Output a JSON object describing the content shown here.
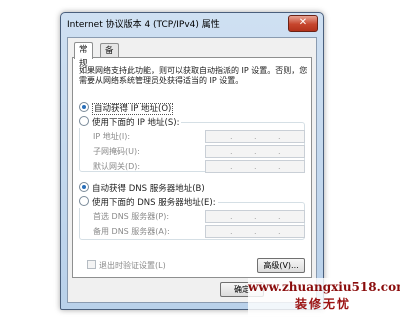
{
  "window": {
    "title": "Internet 协议版本 4 (TCP/IPv4) 属性",
    "close_symbol": "✕"
  },
  "tabs": [
    {
      "label": "常规",
      "active": true
    },
    {
      "label": "备用配置",
      "active": false
    }
  ],
  "description": "如果网络支持此功能，则可以获取自动指派的 IP 设置。否则，您需要从网络系统管理员处获得适当的 IP 设置。",
  "ip_section": {
    "auto_label": "自动获得 IP 地址(O)",
    "manual_label": "使用下面的 IP 地址(S):",
    "auto_selected": true,
    "fields": [
      {
        "label": "IP 地址(I):"
      },
      {
        "label": "子网掩码(U):"
      },
      {
        "label": "默认网关(D):"
      }
    ]
  },
  "dns_section": {
    "auto_label": "自动获得 DNS 服务器地址(B)",
    "manual_label": "使用下面的 DNS 服务器地址(E):",
    "auto_selected": true,
    "fields": [
      {
        "label": "首选 DNS 服务器(P):"
      },
      {
        "label": "备用 DNS 服务器(A):"
      }
    ]
  },
  "validate_checkbox": {
    "label": "退出时验证设置(L)",
    "checked": false
  },
  "advanced_button": "高级(V)...",
  "ok_button": "确定",
  "watermark": {
    "url": "www.zhuangxiu518.com",
    "brand": "装修无忧"
  }
}
